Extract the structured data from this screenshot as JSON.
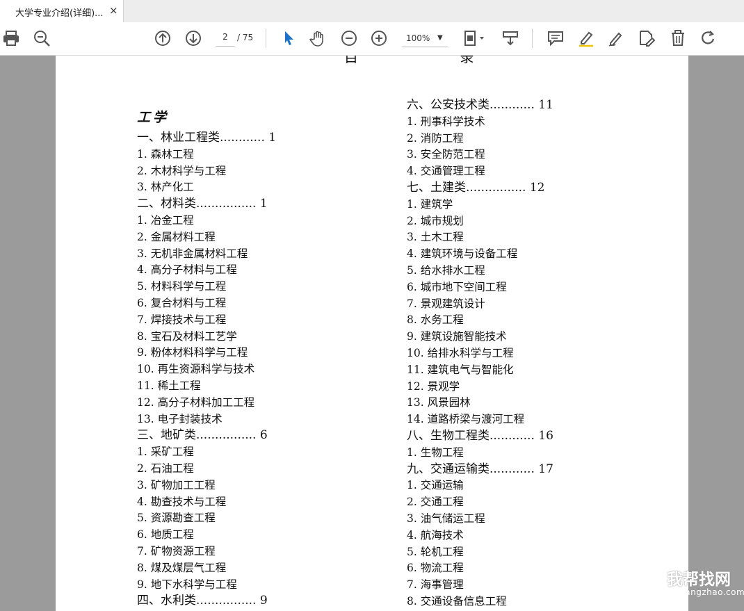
{
  "tab": {
    "title": "大学专业介绍(详细)...",
    "close": "×"
  },
  "toolbar": {
    "page_current": "2",
    "page_total": "/ 75",
    "zoom": "100%"
  },
  "document": {
    "top_title": "目 录",
    "section": "工学",
    "left": [
      {
        "t": "一、林业工程类............ 1",
        "h": true
      },
      {
        "t": "1. 森林工程"
      },
      {
        "t": "2. 木材科学与工程"
      },
      {
        "t": "3. 林产化工"
      },
      {
        "t": "二、材料类................ 1",
        "h": true
      },
      {
        "t": "1. 冶金工程"
      },
      {
        "t": "2. 金属材料工程"
      },
      {
        "t": "3. 无机非金属材料工程"
      },
      {
        "t": "4. 高分子材料与工程"
      },
      {
        "t": "5. 材料科学与工程"
      },
      {
        "t": "6. 复合材料与工程"
      },
      {
        "t": "7. 焊接技术与工程"
      },
      {
        "t": "8. 宝石及材料工艺学"
      },
      {
        "t": "9. 粉体材料科学与工程"
      },
      {
        "t": "10. 再生资源科学与技术"
      },
      {
        "t": "11. 稀土工程"
      },
      {
        "t": "12. 高分子材料加工工程"
      },
      {
        "t": "13. 电子封装技术"
      },
      {
        "t": "三、地矿类................ 6",
        "h": true
      },
      {
        "t": "1. 采矿工程"
      },
      {
        "t": "2. 石油工程"
      },
      {
        "t": "3. 矿物加工工程"
      },
      {
        "t": "4. 勘查技术与工程"
      },
      {
        "t": "5. 资源勘查工程"
      },
      {
        "t": "6. 地质工程"
      },
      {
        "t": "7. 矿物资源工程"
      },
      {
        "t": "8. 煤及煤层气工程"
      },
      {
        "t": "9. 地下水科学与工程"
      },
      {
        "t": "四、水利类................ 9",
        "h": true
      }
    ],
    "right": [
      {
        "t": "六、公安技术类............ 11",
        "h": true
      },
      {
        "t": "1. 刑事科学技术"
      },
      {
        "t": "2. 消防工程"
      },
      {
        "t": "3. 安全防范工程"
      },
      {
        "t": "4. 交通管理工程"
      },
      {
        "t": "七、土建类................ 12",
        "h": true
      },
      {
        "t": "1. 建筑学"
      },
      {
        "t": "2. 城市规划"
      },
      {
        "t": "3. 土木工程"
      },
      {
        "t": "4. 建筑环境与设备工程"
      },
      {
        "t": "5. 给水排水工程"
      },
      {
        "t": "6. 城市地下空间工程"
      },
      {
        "t": "7. 景观建筑设计"
      },
      {
        "t": "8. 水务工程"
      },
      {
        "t": "9. 建筑设施智能技术"
      },
      {
        "t": "10. 给排水科学与工程"
      },
      {
        "t": "11. 建筑电气与智能化"
      },
      {
        "t": "12. 景观学"
      },
      {
        "t": "13. 风景园林"
      },
      {
        "t": "14. 道路桥梁与渡河工程"
      },
      {
        "t": "八、生物工程类............ 16",
        "h": true
      },
      {
        "t": "1. 生物工程"
      },
      {
        "t": "九、交通运输类............ 17",
        "h": true
      },
      {
        "t": "1. 交通运输"
      },
      {
        "t": "2. 交通工程"
      },
      {
        "t": "3. 油气储运工程"
      },
      {
        "t": "4. 航海技术"
      },
      {
        "t": "5. 轮机工程"
      },
      {
        "t": "6. 物流工程"
      },
      {
        "t": "7. 海事管理"
      },
      {
        "t": "8. 交通设备信息工程"
      }
    ]
  },
  "watermark": {
    "text": "我帮找网",
    "sub": "wobangzhao.com"
  }
}
